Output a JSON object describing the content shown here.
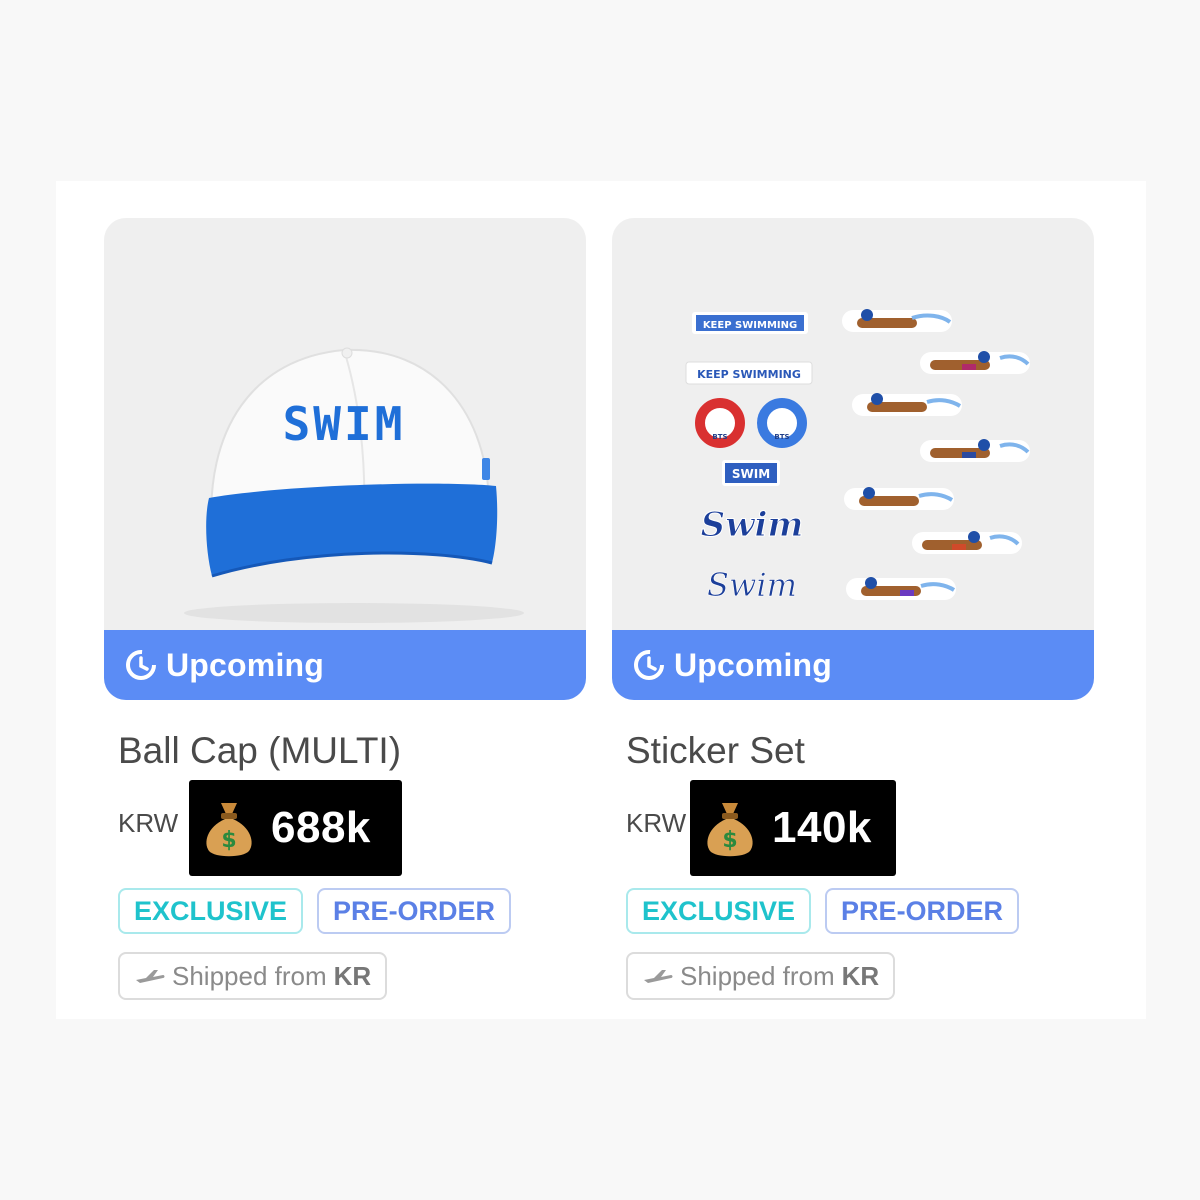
{
  "products": [
    {
      "image_name": "ball-cap",
      "cap_text": "SWIM",
      "status": "Upcoming",
      "title": "Ball Cap (MULTI)",
      "currency": "KRW",
      "price": "688k",
      "tags": [
        "EXCLUSIVE",
        "PRE-ORDER"
      ],
      "shipping_prefix": "Shipped from",
      "shipping_country": "KR"
    },
    {
      "image_name": "sticker-set",
      "sticker_texts": [
        "KEEP SWIMMING",
        "KEEP SWIMMING",
        "BTS",
        "BTS",
        "SWIM",
        "Swim",
        "Swim"
      ],
      "status": "Upcoming",
      "title": "Sticker Set",
      "currency": "KRW",
      "price": "140k",
      "tags": [
        "EXCLUSIVE",
        "PRE-ORDER"
      ],
      "shipping_prefix": "Shipped from",
      "shipping_country": "KR"
    }
  ],
  "colors": {
    "banner": "#5b8cf5",
    "exclusive": "#1fc3cc",
    "preorder": "#5b80e6",
    "price_overlay": "#000000",
    "cap_brim": "#1f6fd8"
  },
  "icons": [
    "clock-icon",
    "money-bag-icon",
    "airplane-icon"
  ]
}
